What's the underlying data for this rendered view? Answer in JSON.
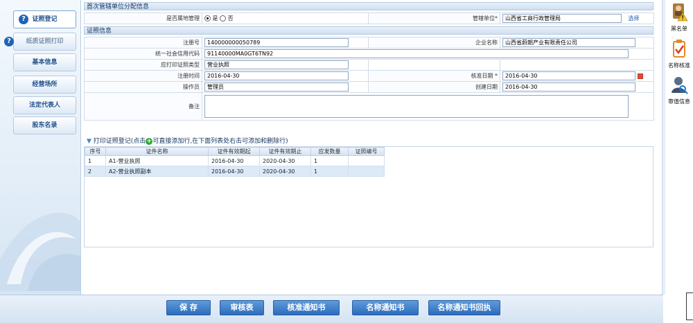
{
  "sidebar": {
    "items": [
      {
        "label": "证照登记",
        "icon": "question-icon"
      },
      {
        "label": "纸质证照打印",
        "icon": "question-icon"
      },
      {
        "label": "基本信息"
      },
      {
        "label": "经营场所"
      },
      {
        "label": "法定代表人"
      },
      {
        "label": "股东名录"
      }
    ]
  },
  "section1": {
    "title": "首次管辖单位分配信息",
    "local_label": "是否属地管理",
    "radio_yes": "是",
    "radio_no": "否",
    "radio_selected": "是",
    "authority_label": "管辖单位*",
    "authority_value": "山西省工商行政管理局",
    "select_link": "选择"
  },
  "section2": {
    "title": "证照信息",
    "reg_no_label": "注册号",
    "reg_no": "140000000050789",
    "company_label": "企业名称",
    "company": "山西省蔚朗产业有限责任公司",
    "credit_label": "统一社会信用代码",
    "credit_code": "91140000MA0GT6TN92",
    "cert_type_label": "应打印证照类型",
    "cert_type": "营业执照",
    "reg_time_label": "注册时间",
    "reg_time": "2016-04-30",
    "approval_label": "核准日期 *",
    "approval_date": "2016-04-30",
    "operator_label": "操作员",
    "operator": "管理员",
    "created_label": "创建日期",
    "created_date": "2016-04-30",
    "remark_label": "备注",
    "remark": ""
  },
  "print_section": {
    "title_before": "打印证照登记(点击",
    "title_after": "可直接添加行,在下面列表处右击可添加和删除行)",
    "columns": [
      "序号",
      "证件名称",
      "证件有效期起",
      "证件有效期止",
      "应发数量",
      "证照编号"
    ],
    "rows": [
      {
        "no": "1",
        "name": "A1-营业执照",
        "start": "2016-04-30",
        "end": "2020-04-30",
        "qty": "1",
        "code": ""
      },
      {
        "no": "2",
        "name": "A2-营业执照副本",
        "start": "2016-04-30",
        "end": "2020-04-30",
        "qty": "1",
        "code": ""
      }
    ]
  },
  "buttons": {
    "save": "保 存",
    "review": "审核表",
    "approve_notice": "核准通知书",
    "name_notice": "名称通知书",
    "name_notice_receipt": "名称通知书回执"
  },
  "rail": {
    "blacklist": "黑名单",
    "name_check": "名称核准",
    "review_info": "审值信息"
  },
  "colors": {
    "accent": "#1f63b4",
    "button": "#2c6cbc",
    "header_bg": "#cfdff1",
    "row_alt": "#dde9f6"
  }
}
